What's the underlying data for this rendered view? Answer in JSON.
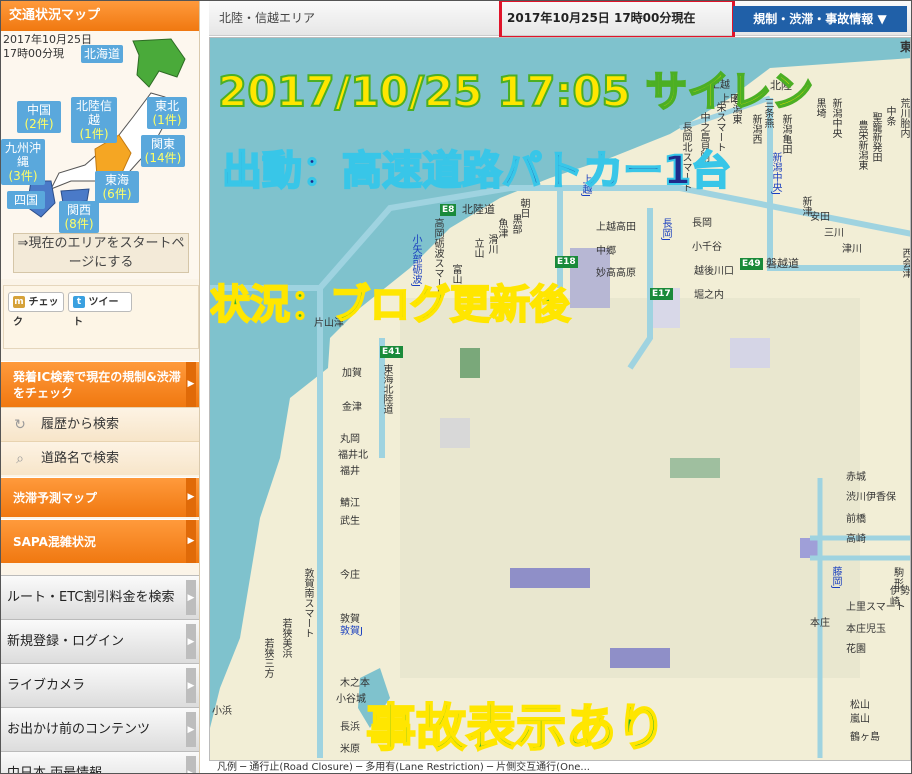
{
  "sidebar": {
    "header_title": "交通状況マップ",
    "minimap": {
      "date_line1": "2017年10月25日",
      "date_line2": "17時00分現",
      "regions": [
        {
          "name": "北海道",
          "count": ""
        },
        {
          "name": "中国",
          "count": "(2件)"
        },
        {
          "name": "北陸信越",
          "count": "(1件)"
        },
        {
          "name": "東北",
          "count": "(1件)"
        },
        {
          "name": "九州沖縄",
          "count": "(3件)"
        },
        {
          "name": "関東",
          "count": "(14件)"
        },
        {
          "name": "東海",
          "count": "(6件)"
        },
        {
          "name": "四国",
          "count": ""
        },
        {
          "name": "関西",
          "count": "(8件)"
        }
      ],
      "start_page_label": "⇒現在のエリアをスタートページにする"
    },
    "share": {
      "check_label": "チェック",
      "tweet_label": "ツイート"
    },
    "search_ic_label": "発着IC検索で現在の規制&渋滞をチェック",
    "history_search_label": "履歴から検索",
    "road_search_label": "道路名で検索",
    "congestion_forecast_label": "渋滞予測マップ",
    "sapa_label": "SAPA混雑状況",
    "gray_menu": [
      "ルート・ETC割引料金を検索",
      "新規登録・ログイン",
      "ライブカメラ",
      "お出かけ前のコンテンツ",
      "中日本 両最情報"
    ]
  },
  "header": {
    "area_label": "北陸・信越エリア",
    "timestamp": "2017年10月25日 17時00分現在",
    "regulation_button": "規制・渋滞・事故情報 ▼"
  },
  "overlay": {
    "line1": "2017/10/25 17:05 サイレン",
    "line2": "出動：高速道路パトカー1台",
    "line3": "状況：ブログ更新後",
    "line4": "事故表示あり"
  },
  "map": {
    "roads": {
      "hokuriku": "北陸道",
      "bandai": "磐越道",
      "e8": "E8",
      "e49": "E49",
      "e41": "E41",
      "e17": "E17",
      "e18": "E18"
    },
    "cities_west": [
      "片山津",
      "加賀",
      "金津",
      "丸岡",
      "福井北",
      "福井",
      "鯖江",
      "武生",
      "今庄",
      "敦賀南スマート",
      "敦賀",
      "敦賀J",
      "若狭美浜",
      "若狭三方",
      "木之本",
      "小谷城",
      "長浜",
      "米原",
      "小浜"
    ],
    "cities_north": [
      "高岡砺波スマート",
      "小矢部砺波J",
      "富山",
      "立山",
      "滑川",
      "魚津",
      "黒部",
      "朝日",
      "上越J",
      "上越高田",
      "中郷",
      "妙高高原",
      "長岡J",
      "長岡",
      "小千谷",
      "越後川口",
      "堀之内",
      "新潟中央J",
      "新潟西",
      "新潟亀田",
      "新津",
      "安田",
      "三川",
      "津川",
      "西会津",
      "長岡北スマート",
      "中之島見附",
      "栄スマート",
      "巻潟東",
      "三条燕",
      "黒埼",
      "新潟中央",
      "豊栄新潟東",
      "聖籠新発田",
      "中条",
      "荒川胎内",
      "北陸",
      "上越",
      "上田"
    ],
    "cities_east": [
      "赤城",
      "渋川伊香保",
      "前橋",
      "高崎",
      "藤岡J",
      "本庄児玉",
      "花園",
      "上里スマート",
      "本庄",
      "鶴ヶ島",
      "松山",
      "嵐山",
      "駒形",
      "伊勢崎"
    ],
    "e41_label": "東海北陸道",
    "east_edge_label": "東"
  },
  "legend": {
    "text": "凡例 ─ 通行止(Road Closure) ─ 多用有(Lane Restriction) ─ 片側交互通行(One..."
  }
}
